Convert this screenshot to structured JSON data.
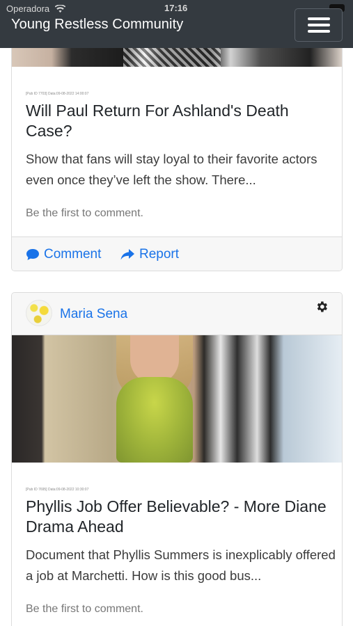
{
  "statusbar": {
    "carrier": "Operadora",
    "time": "17:16"
  },
  "navbar": {
    "title": "Young Restless Community",
    "menu_icon": "hamburger-menu-icon"
  },
  "posts": [
    {
      "meta": "[Pub ID 7703] Data:09-08-2022 14:00:07",
      "title": "Will Paul Return For Ashland's Death Case?",
      "excerpt": "Show that fans will stay loyal to their favorite actors even once they’ve left the show. There...",
      "first_comment": "Be the first to comment.",
      "actions": {
        "comment": "Comment",
        "report": "Report"
      }
    },
    {
      "author": "Maria Sena",
      "meta": "[Pub ID 7695] Data:09-08-2022 10:30:07",
      "title": "Phyllis Job Offer Believable? - More Diane Drama Ahead",
      "excerpt": "Document that Phyllis Summers  is inexplicably offered a job at Marchetti. How is this good bus...",
      "first_comment": "Be the first to comment."
    }
  ],
  "colors": {
    "navbar": "#343a40",
    "link": "#1a73e8",
    "card_border": "#dcdcdc",
    "footer_bg": "#f7f7f7"
  }
}
